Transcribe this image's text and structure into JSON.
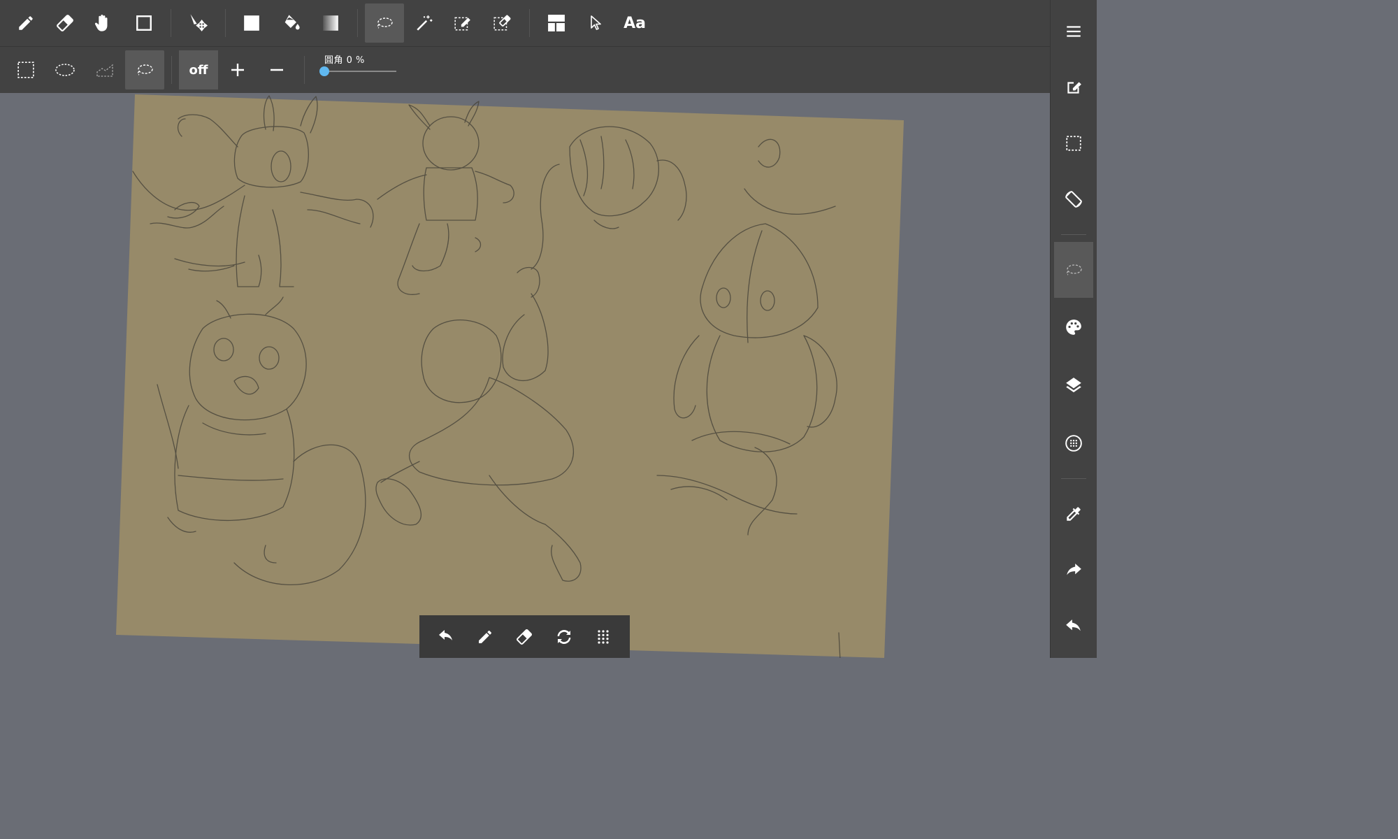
{
  "toolbar_main": {
    "tools": [
      {
        "name": "pen-tool",
        "icon": "pencil-icon"
      },
      {
        "name": "eraser-tool",
        "icon": "eraser-icon"
      },
      {
        "name": "hand-tool",
        "icon": "hand-icon"
      },
      {
        "name": "shape-tool",
        "icon": "rectangle-icon"
      },
      {
        "name": "move-tool",
        "icon": "move-arrow-icon"
      },
      {
        "name": "fill-rect-tool",
        "icon": "filled-square-icon"
      },
      {
        "name": "bucket-tool",
        "icon": "paint-bucket-icon"
      },
      {
        "name": "gradient-tool",
        "icon": "gradient-icon"
      },
      {
        "name": "lasso-select-tool",
        "icon": "lasso-icon",
        "active": true
      },
      {
        "name": "magic-wand-tool",
        "icon": "magic-wand-icon"
      },
      {
        "name": "select-pen-tool",
        "icon": "select-pen-icon"
      },
      {
        "name": "select-eraser-tool",
        "icon": "select-eraser-icon"
      },
      {
        "name": "frame-divider-tool",
        "icon": "frame-icon"
      },
      {
        "name": "operation-tool",
        "icon": "cursor-icon"
      },
      {
        "name": "text-tool",
        "icon": "text-icon",
        "label": "Aa"
      }
    ]
  },
  "toolbar_sub": {
    "modes": [
      "rect-select",
      "ellipse-select",
      "polyline-select",
      "lasso-select"
    ],
    "active_mode": "lasso-select",
    "antialias_label": "off",
    "corner_label": "圓角 0 %",
    "corner_value": 0
  },
  "sidebar": {
    "items": [
      "menu-icon",
      "edit-icon",
      "selection-icon",
      "rotate-screen-icon",
      "lasso-icon",
      "palette-icon",
      "layers-icon",
      "material-icon",
      "eyedropper-icon",
      "redo-icon",
      "undo-icon"
    ]
  },
  "bottom_bar": {
    "items": [
      "undo-icon",
      "pencil-icon",
      "eraser-icon",
      "transform-icon",
      "grid-icon"
    ]
  },
  "colors": {
    "toolbar_bg": "#424242",
    "active_bg": "#595959",
    "workspace_bg": "#6a6d75",
    "paper": "#978a69",
    "sketch_line": "#4a463c",
    "accent": "#60b8f0"
  }
}
